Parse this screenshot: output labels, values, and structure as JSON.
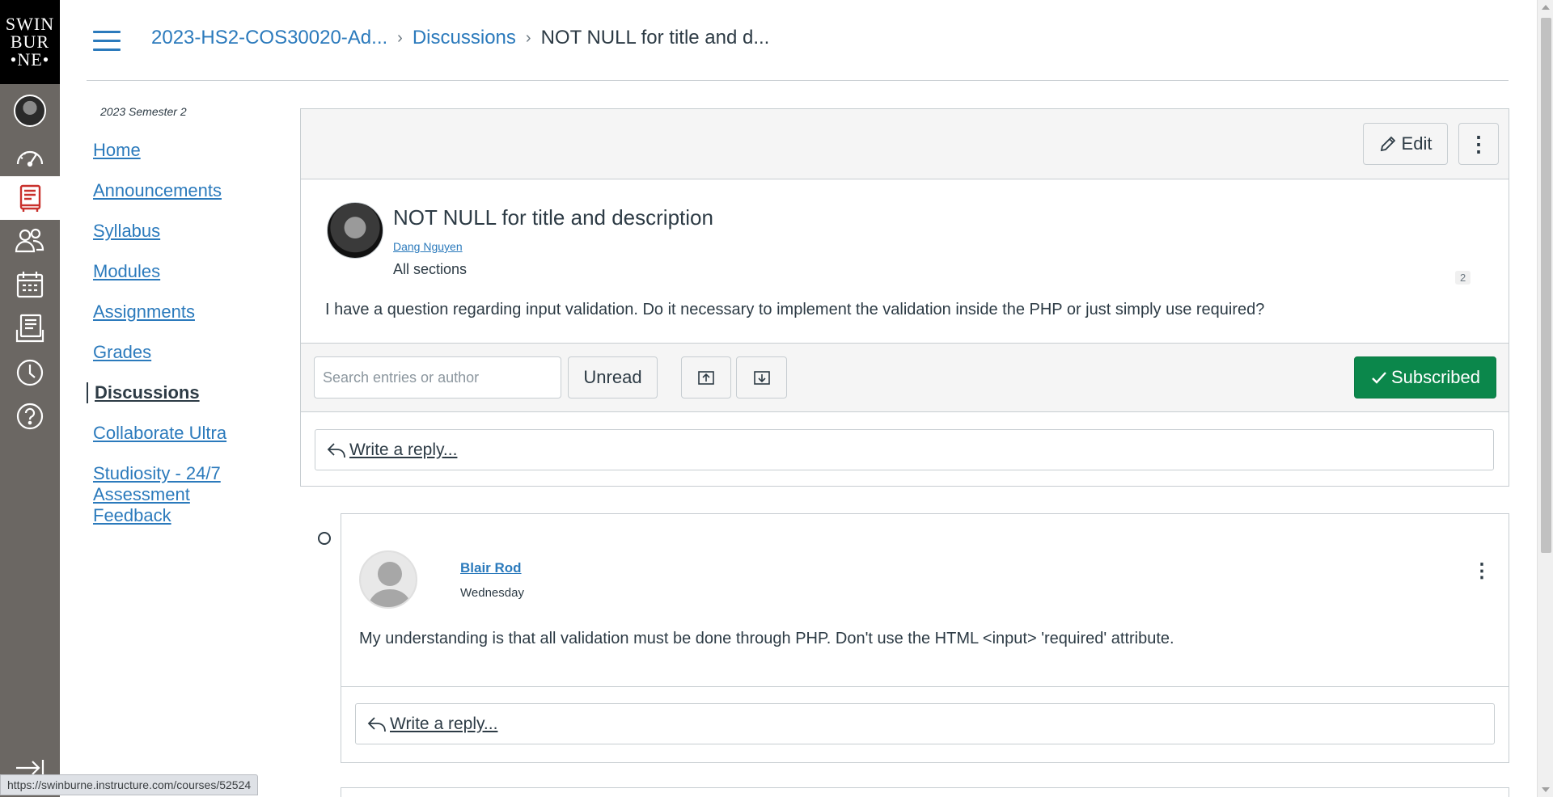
{
  "logo": {
    "line1": "SWIN",
    "line2": "BUR",
    "line3": "•NE•"
  },
  "global_nav": {
    "items": [
      "account",
      "dashboard",
      "courses",
      "groups",
      "calendar",
      "inbox",
      "history",
      "help"
    ]
  },
  "breadcrumb": {
    "course": "2023-HS2-COS30020-Ad...",
    "section": "Discussions",
    "current": "NOT NULL for title and d..."
  },
  "course_nav": {
    "term": "2023 Semester 2",
    "items": [
      {
        "label": "Home"
      },
      {
        "label": "Announcements"
      },
      {
        "label": "Syllabus"
      },
      {
        "label": "Modules"
      },
      {
        "label": "Assignments"
      },
      {
        "label": "Grades"
      },
      {
        "label": "Discussions",
        "active": true
      },
      {
        "label": "Collaborate Ultra"
      },
      {
        "label": "Studiosity - 24/7 Assessment Feedback"
      }
    ]
  },
  "topic": {
    "edit_label": "Edit",
    "title": "NOT NULL for title and description",
    "author": "Dang Nguyen",
    "sections": "All sections",
    "reply_count": "2",
    "body": "I have a question regarding input validation. Do it necessary to implement the validation inside the PHP or just simply use required?",
    "search_placeholder": "Search entries or author",
    "unread_label": "Unread",
    "subscribed_label": "Subscribed",
    "reply_label": "Write a reply..."
  },
  "entry": {
    "author": "Blair Rod",
    "date": "Wednesday",
    "body": "My understanding is that all validation must be done through PHP. Don't use the HTML <input> 'required' attribute.",
    "reply_label": "Write a reply..."
  },
  "status_bar": {
    "url": "https://swinburne.instructure.com/courses/52524"
  },
  "colors": {
    "nav_bg": "#6b6763",
    "link": "#2b7abc",
    "subscribed": "#0b874b",
    "active_icon": "#c9302c"
  }
}
